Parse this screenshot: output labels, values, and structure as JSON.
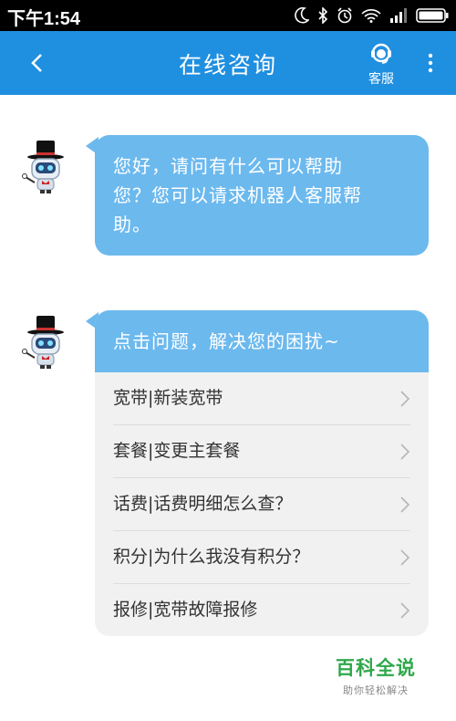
{
  "status_bar": {
    "time": "下午1:54",
    "icons": [
      "moon-icon",
      "bluetooth-icon",
      "alarm-icon",
      "wifi-icon",
      "signal-icon",
      "battery-icon"
    ]
  },
  "header": {
    "title": "在线咨询",
    "service_label": "客服",
    "icons": [
      "back-icon",
      "customer-service-icon",
      "more-icon"
    ],
    "color": "#1f8fe0"
  },
  "chat": {
    "greeting": "您好，请问有什么可以帮助您？您可以请求机器人客服帮助。",
    "greeting_lines": [
      "您好，请问有什么可以帮助",
      "您？您可以请求机器人客服帮",
      "助。"
    ],
    "faq_title": "点击问题，解决您的困扰~",
    "faq_items": [
      {
        "label": "宽带|新装宽带"
      },
      {
        "label": "套餐|变更主套餐"
      },
      {
        "label": "话费|话费明细怎么查？"
      },
      {
        "label": "积分|为什么我没有积分？"
      },
      {
        "label": "报修|宽带故障报修"
      }
    ],
    "bubble_color": "#6cb9ee"
  },
  "watermark": {
    "title": "百科全说",
    "subtitle": "助你轻松解决"
  }
}
